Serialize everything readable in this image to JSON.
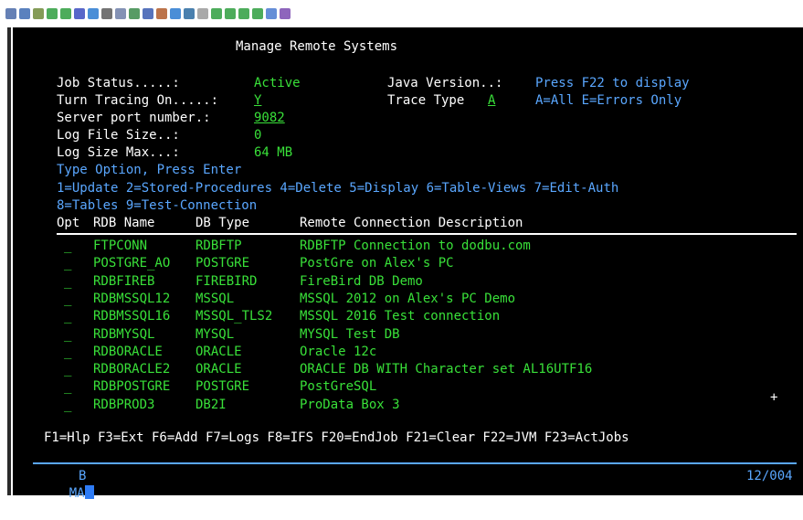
{
  "toolbar": {
    "icons": [
      "app-icon",
      "copy-icon",
      "paste-icon",
      "send-icon",
      "receive-icon",
      "file-icon",
      "refresh-icon",
      "screen-icon",
      "toolbar-icon-9",
      "toolbar-icon-10",
      "toolbar-icon-11",
      "toolbar-icon-12",
      "toolbar-icon-13",
      "toolbar-icon-14",
      "tools-icon",
      "user-icon",
      "transfer-icon",
      "chart-icon",
      "stats-icon",
      "doc-icon",
      "help-icon"
    ]
  },
  "screen": {
    "title": "Manage Remote Systems",
    "fields": {
      "job_status_label": "Job Status.....:",
      "job_status_value": "Active",
      "java_version_label": "Java Version..:",
      "java_version_value": "Press F22 to display",
      "tracing_label": "Turn Tracing On.....:",
      "tracing_value": "Y",
      "trace_type_label": "Trace Type",
      "trace_type_value": "A",
      "trace_type_hint": "A=All E=Errors Only",
      "port_label": "Server port number.:",
      "port_value": "9082",
      "log_file_size_label": "Log File Size..:",
      "log_file_size_value": "0",
      "log_size_max_label": "Log Size Max...:",
      "log_size_max_value": "64 MB"
    },
    "instructions": "Type Option, Press Enter",
    "options_line1": "1=Update 2=Stored-Procedures 4=Delete 5=Display 6=Table-Views 7=Edit-Auth",
    "options_line2": "8=Tables 9=Test-Connection",
    "table": {
      "headers": [
        "Opt",
        "RDB Name",
        "DB Type",
        "Remote Connection Description"
      ],
      "rows": [
        {
          "opt": "_",
          "rdb": "FTPCONN",
          "type": "RDBFTP",
          "desc": "RDBFTP Connection to dodbu.com"
        },
        {
          "opt": "_",
          "rdb": "POSTGRE_AO",
          "type": "POSTGRE",
          "desc": "PostGre on Alex's PC"
        },
        {
          "opt": "_",
          "rdb": "RDBFIREB",
          "type": "FIREBIRD",
          "desc": "FireBird DB Demo"
        },
        {
          "opt": "_",
          "rdb": "RDBMSSQL12",
          "type": "MSSQL",
          "desc": "MSSQL 2012 on Alex's PC Demo"
        },
        {
          "opt": "_",
          "rdb": "RDBMSSQL16",
          "type": "MSSQL_TLS2",
          "desc": "MSSQL 2016 Test connection"
        },
        {
          "opt": "_",
          "rdb": "RDBMYSQL",
          "type": "MYSQL",
          "desc": "MYSQL Test DB"
        },
        {
          "opt": "_",
          "rdb": "RDBORACLE",
          "type": "ORACLE",
          "desc": "Oracle 12c"
        },
        {
          "opt": "_",
          "rdb": "RDBORACLE2",
          "type": "ORACLE",
          "desc": "ORACLE DB WITH Character set AL16UTF16"
        },
        {
          "opt": "_",
          "rdb": "RDBPOSTGRE",
          "type": "POSTGRE",
          "desc": "PostGreSQL"
        },
        {
          "opt": "_",
          "rdb": "RDBPROD3",
          "type": "DB2I",
          "desc": "ProData Box 3"
        }
      ],
      "more_indicator": "+"
    },
    "function_keys": "F1=Hlp F3=Ext F6=Add F7=Logs F8=IFS F20=EndJob F21=Clear F22=JVM F23=ActJobs",
    "status": {
      "mode": "MA",
      "session": "B",
      "cursor_position": "12/004"
    }
  }
}
